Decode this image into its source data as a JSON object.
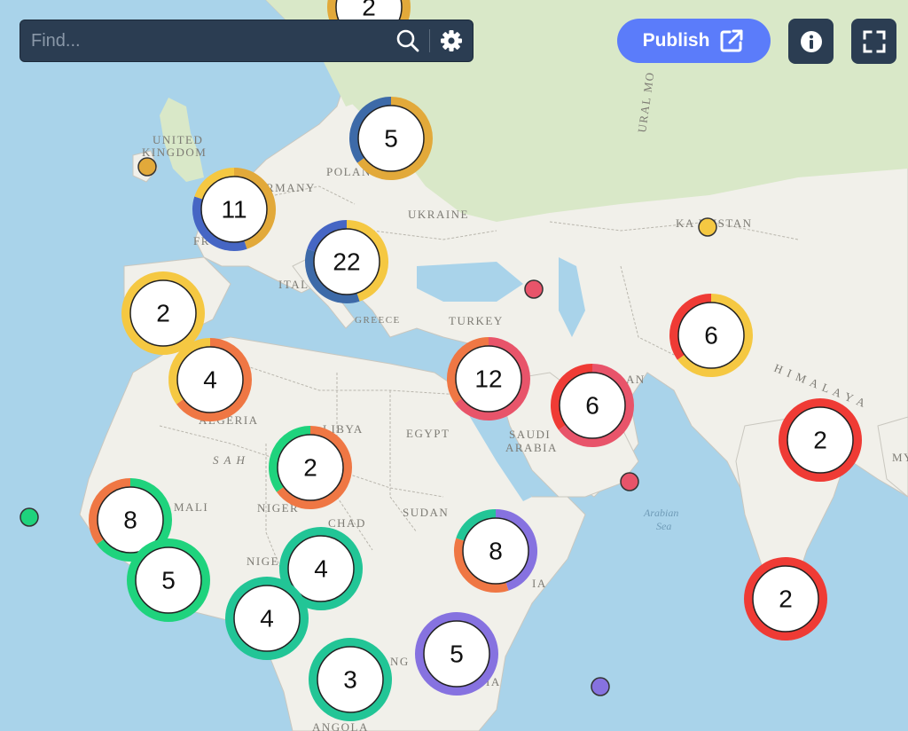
{
  "search": {
    "placeholder": "Find..."
  },
  "toolbar": {
    "publish_label": "Publish"
  },
  "icons": {
    "search": "search-icon",
    "settings": "gear-icon",
    "publish": "external-link-icon",
    "info": "info-icon",
    "fullscreen": "fullscreen-icon"
  },
  "map_labels": {
    "united": "UNITED",
    "kingdom": "KINGDOM",
    "poland": "POLAN",
    "germany": "RMANY",
    "ukraine": "UKRAINE",
    "kazakhstan": "KA   KHSTAN",
    "italy": "ITAL",
    "greece": "GREECE",
    "turkey": "TURKEY",
    "algeria": "ALGERIA",
    "libya": "LIBYA",
    "egypt": "EGYPT",
    "saudi": "SAUDI",
    "arabia": "ARABIA",
    "sahara": "S A H",
    "mali": "MALI",
    "niger": "NIGER",
    "chad": "CHAD",
    "sudan": "SUDAN",
    "nigeria": "NIGE",
    "arabian": "Arabian",
    "sea": "Sea",
    "ural": "URAL MO",
    "himalaya": "H I M A L A Y A",
    "iran": "AN",
    "angola": "ANGOLA",
    "congo": "NG",
    "tanzania": "IA",
    "ethiopia": "IA",
    "fr": "FR",
    "my": "MY"
  },
  "colors": {
    "green": "#1fd37d",
    "teal": "#22c596",
    "yellow": "#f5c842",
    "gold": "#e2a93a",
    "blue": "#4666c4",
    "steel": "#3d6aa8",
    "red": "#ef3b35",
    "pink": "#e8546a",
    "orange": "#ef7744",
    "purple": "#8672e0"
  },
  "clusters": [
    {
      "id": "c-north",
      "count": "2",
      "ring": [
        "gold"
      ]
    },
    {
      "id": "c-poland",
      "count": "5",
      "ring": [
        "gold",
        "steel"
      ]
    },
    {
      "id": "c-france",
      "count": "11",
      "ring": [
        "gold",
        "blue",
        "yellow"
      ]
    },
    {
      "id": "c-italy",
      "count": "22",
      "ring": [
        "yellow",
        "steel",
        "blue"
      ]
    },
    {
      "id": "c-spain",
      "count": "2",
      "ring": [
        "yellow"
      ]
    },
    {
      "id": "c-morocco",
      "count": "4",
      "ring": [
        "orange",
        "yellow"
      ]
    },
    {
      "id": "c-turkey",
      "count": "12",
      "ring": [
        "pink",
        "orange"
      ]
    },
    {
      "id": "c-saudi",
      "count": "6",
      "ring": [
        "pink",
        "red"
      ]
    },
    {
      "id": "c-pakistan",
      "count": "6",
      "ring": [
        "yellow",
        "red"
      ]
    },
    {
      "id": "c-india-n",
      "count": "2",
      "ring": [
        "red"
      ]
    },
    {
      "id": "c-india-s",
      "count": "2",
      "ring": [
        "red"
      ]
    },
    {
      "id": "c-libya",
      "count": "2",
      "ring": [
        "orange",
        "green"
      ]
    },
    {
      "id": "c-westafrica",
      "count": "8",
      "ring": [
        "green",
        "orange"
      ]
    },
    {
      "id": "c-guinea",
      "count": "5",
      "ring": [
        "green"
      ]
    },
    {
      "id": "c-nigeria",
      "count": "4",
      "ring": [
        "teal"
      ]
    },
    {
      "id": "c-cameroon",
      "count": "4",
      "ring": [
        "teal"
      ]
    },
    {
      "id": "c-congo",
      "count": "3",
      "ring": [
        "teal"
      ]
    },
    {
      "id": "c-ethiopia",
      "count": "8",
      "ring": [
        "purple",
        "orange",
        "teal"
      ]
    },
    {
      "id": "c-kenya",
      "count": "5",
      "ring": [
        "purple"
      ]
    }
  ],
  "markers": [
    {
      "id": "m-ireland",
      "color": "gold"
    },
    {
      "id": "m-kazakhstan",
      "color": "yellow"
    },
    {
      "id": "m-georgia",
      "color": "pink"
    },
    {
      "id": "m-oman",
      "color": "pink"
    },
    {
      "id": "m-atlantic",
      "color": "green"
    },
    {
      "id": "m-indian-ocean",
      "color": "purple"
    }
  ]
}
